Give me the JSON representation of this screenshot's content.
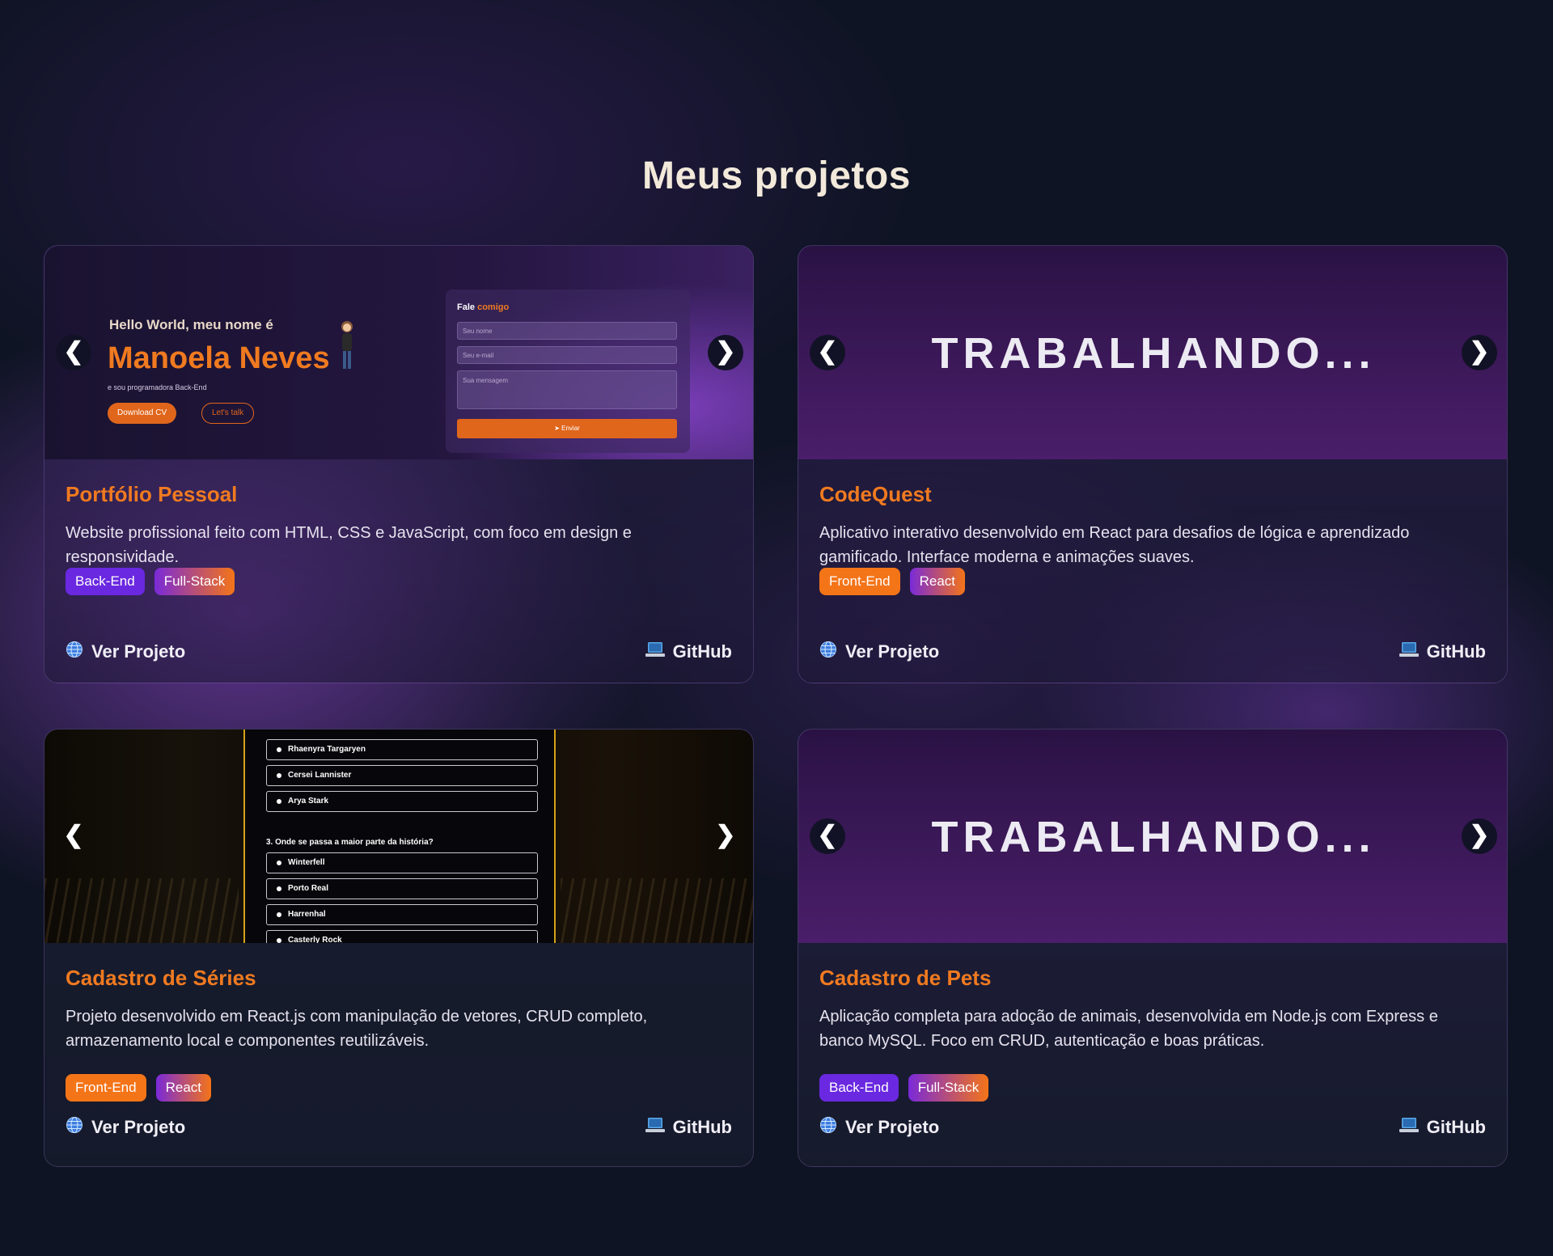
{
  "page_title": "Meus projetos",
  "colors": {
    "accent": "#f07a20",
    "purple": "#6a28e0",
    "background": "#0f1424"
  },
  "icons": {
    "prev": "chevron-left-icon",
    "next": "chevron-right-icon",
    "site": "globe-icon",
    "repo": "laptop-icon"
  },
  "carousel": {
    "prev": "❮",
    "next": "❯"
  },
  "projects": [
    {
      "title": "Portfólio Pessoal",
      "description": "Website profissional feito com HTML, CSS e JavaScript, com foco em design e responsividade.",
      "tags": [
        "Back-End",
        "Full-Stack"
      ],
      "view_label": "Ver Projeto",
      "github_label": "GitHub",
      "preview": {
        "hello": "Hello World, meu nome é",
        "name": "Manoela Neves",
        "subtitle": "e sou programadora Back-End",
        "download_cv": "Download CV",
        "lets_talk": "Let's talk",
        "form_title": "Fale",
        "form_title_accent": "comigo",
        "name_placeholder": "Seu nome",
        "email_placeholder": "Seu e-mail",
        "message_placeholder": "Sua mensagem",
        "send": "Enviar"
      }
    },
    {
      "title": "CodeQuest",
      "description": "Aplicativo interativo desenvolvido em React para desafios de lógica e aprendizado gamificado. Interface moderna e animações suaves.",
      "tags": [
        "Front-End",
        "React"
      ],
      "view_label": "Ver Projeto",
      "github_label": "GitHub",
      "preview": {
        "text": "TRABALHANDO..."
      }
    },
    {
      "title": "Cadastro de Séries",
      "description": "Projeto desenvolvido em React.js com manipulação de vetores, CRUD completo, armazenamento local e componentes reutilizáveis.",
      "tags": [
        "Front-End",
        "React"
      ],
      "view_label": "Ver Projeto",
      "github_label": "GitHub",
      "preview": {
        "options_top": [
          "Rhaenyra Targaryen",
          "Cersei Lannister",
          "Arya Stark"
        ],
        "question": "3. Onde se passa a maior parte da história?",
        "options_bottom": [
          "Winterfell",
          "Porto Real",
          "Harrenhal",
          "Casterly Rock"
        ]
      }
    },
    {
      "title": "Cadastro de Pets",
      "description": "Aplicação completa para adoção de animais, desenvolvida em Node.js com Express e banco MySQL. Foco em CRUD, autenticação e boas práticas.",
      "tags": [
        "Back-End",
        "Full-Stack"
      ],
      "view_label": "Ver Projeto",
      "github_label": "GitHub",
      "preview": {
        "text": "TRABALHANDO..."
      }
    }
  ]
}
